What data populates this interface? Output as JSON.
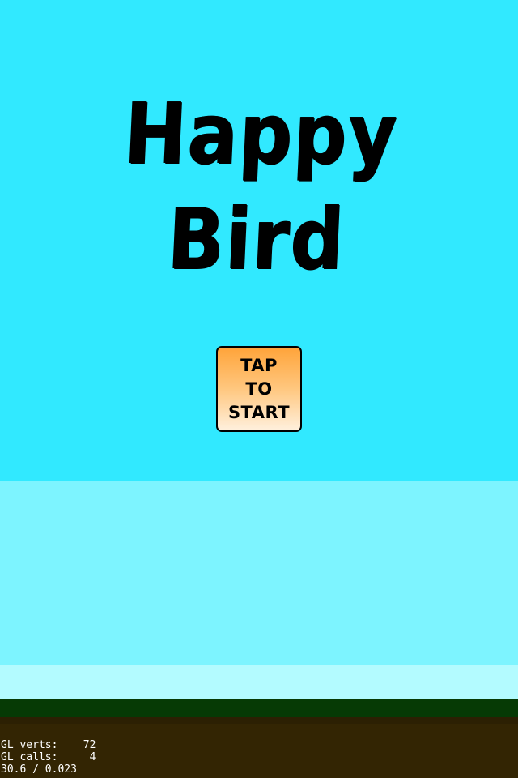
{
  "game": {
    "title": "Happy Bird"
  },
  "start_button": {
    "line1": "TAP",
    "line2": "TO",
    "line3": "START"
  },
  "debug": {
    "verts_label": "GL verts:",
    "verts_value": "72",
    "calls_label": "GL calls:",
    "calls_value": "4",
    "fps_line": "30.6 / 0.023"
  },
  "colors": {
    "sky": "#31e9ff",
    "haze": "#7df4ff",
    "horizon": "#b3fbff",
    "grass": "#063a05",
    "dirt": "#332503",
    "button_top": "#ffa43a",
    "button_bottom": "#fff0dd"
  }
}
